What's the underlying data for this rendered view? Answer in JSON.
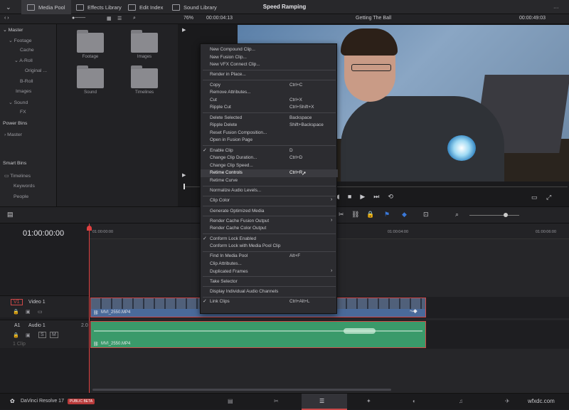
{
  "topbar": {
    "title": "Speed Ramping",
    "tabs": [
      {
        "label": "Media Pool",
        "icon": "media-pool-icon"
      },
      {
        "label": "Effects Library",
        "icon": "effects-icon"
      },
      {
        "label": "Edit Index",
        "icon": "list-icon"
      },
      {
        "label": "Sound Library",
        "icon": "sound-icon"
      }
    ]
  },
  "viewer": {
    "zoom": "76%",
    "source_timecode": "00:00:04:13",
    "clip_name": "Getting The Ball",
    "record_timecode": "00:00:49:03"
  },
  "bins": {
    "items": [
      "Master",
      "Footage",
      "Cache",
      "A-Roll",
      "Original ...",
      "B-Roll",
      "Images",
      "Sound",
      "FX"
    ]
  },
  "power_bins": {
    "title": "Power Bins",
    "items": [
      "Master"
    ]
  },
  "smart_bins": {
    "title": "Smart Bins",
    "items": [
      "Timelines",
      "Keywords",
      "People"
    ]
  },
  "media_pool": {
    "folders": [
      "Footage",
      "Images",
      "Sound",
      "Timelines"
    ]
  },
  "timeline": {
    "timecode": "01:00:00:00",
    "ruler": [
      "01:00:00:00",
      "01:00:04:00",
      "01:00:06:00"
    ],
    "video_track": {
      "id": "V1",
      "name": "Video 1",
      "clip": "MVI_2550.MP4"
    },
    "audio_track": {
      "id": "A1",
      "name": "Audio 1",
      "level": "2.0",
      "info": "1 Clip",
      "clip": "MVI_2550.MP4",
      "s": "S",
      "m": "M"
    }
  },
  "context_menu": {
    "groups": [
      [
        {
          "label": "New Compound Clip..."
        },
        {
          "label": "New Fusion Clip..."
        },
        {
          "label": "New VFX Connect Clip..."
        }
      ],
      [
        {
          "label": "Render in Place..."
        }
      ],
      [
        {
          "label": "Copy",
          "shortcut": "Ctrl+C"
        },
        {
          "label": "Remove Attributes..."
        },
        {
          "label": "Cut",
          "shortcut": "Ctrl+X"
        },
        {
          "label": "Ripple Cut",
          "shortcut": "Ctrl+Shift+X"
        }
      ],
      [
        {
          "label": "Delete Selected",
          "shortcut": "Backspace"
        },
        {
          "label": "Ripple Delete",
          "shortcut": "Shift+Backspace"
        },
        {
          "label": "Reset Fusion Composition..."
        },
        {
          "label": "Open in Fusion Page"
        }
      ],
      [
        {
          "label": "Enable Clip",
          "shortcut": "D",
          "checked": true
        },
        {
          "label": "Change Clip Duration...",
          "shortcut": "Ctrl+D"
        },
        {
          "label": "Change Clip Speed..."
        },
        {
          "label": "Retime Controls",
          "shortcut": "Ctrl+R",
          "highlighted": true
        },
        {
          "label": "Retime Curve"
        }
      ],
      [
        {
          "label": "Normalize Audio Levels..."
        }
      ],
      [
        {
          "label": "Clip Color",
          "submenu": true
        }
      ],
      [
        {
          "label": "Generate Optimized Media"
        }
      ],
      [
        {
          "label": "Render Cache Fusion Output",
          "submenu": true
        },
        {
          "label": "Render Cache Color Output"
        }
      ],
      [
        {
          "label": "Conform Lock Enabled",
          "checked": true
        },
        {
          "label": "Conform Lock with Media Pool Clip"
        }
      ],
      [
        {
          "label": "Find In Media Pool",
          "shortcut": "Alt+F"
        },
        {
          "label": "Clip Attributes..."
        },
        {
          "label": "Duplicated Frames",
          "submenu": true
        }
      ],
      [
        {
          "label": "Take Selector"
        }
      ],
      [
        {
          "label": "Display Individual Audio Channels"
        }
      ],
      [
        {
          "label": "Link Clips",
          "shortcut": "Ctrl+Alt+L",
          "checked": true
        }
      ]
    ]
  },
  "bottombar": {
    "app": "DaVinci Resolve 17",
    "badge": "PUBLIC BETA",
    "watermark": "wfxdc.com"
  },
  "colors": {
    "accent": "#d04848",
    "audio_clip": "#3a9a6a",
    "video_clip": "#4a6a9a",
    "playhead": "#e04040"
  }
}
